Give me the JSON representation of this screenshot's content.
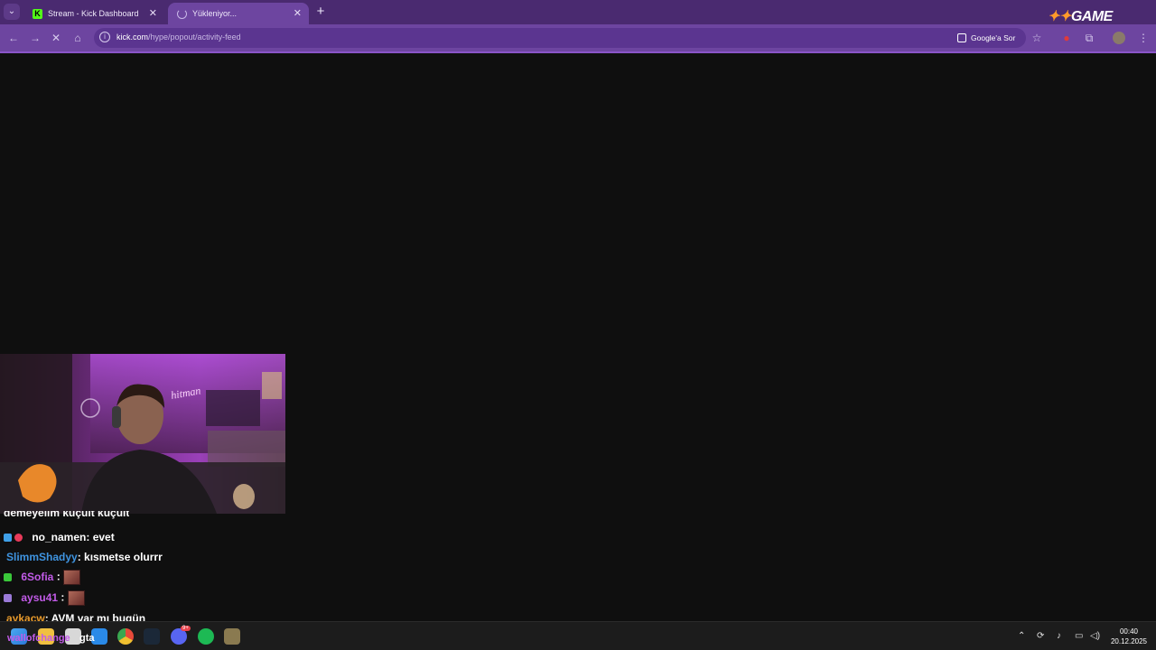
{
  "browser": {
    "tabs": [
      {
        "title": "Stream - Kick Dashboard",
        "favicon": "kick-icon"
      },
      {
        "title": "Yükleniyor...",
        "favicon": "loading-spinner-icon"
      }
    ],
    "url_host": "kick.com",
    "url_path": "/hype/popout/activity-feed",
    "google_sor": "Google'a Sor",
    "overlay_logo": "GAME",
    "theme_color": "#6d45a0"
  },
  "chat": {
    "partial_line": "demeyelim küçült küçült",
    "messages": [
      {
        "user": "no_namen",
        "text": ": evet",
        "user_color": "#ffffff",
        "emote": false
      },
      {
        "user": "SlimmShadyy",
        "text": ": kısmetse olurrr",
        "user_color": "#3f94e0",
        "emote": false
      },
      {
        "user": "6Sofia",
        "text": " :",
        "user_color": "#c25be8",
        "emote": true
      },
      {
        "user": "aysu41",
        "text": " :",
        "user_color": "#c25be8",
        "emote": true
      },
      {
        "user": "aykacw",
        "text": ": AVM var mı bugün",
        "user_color": "#e89a2b",
        "emote": false
      }
    ],
    "overlap_text": "wallofchange",
    "overlap_text2": "gta"
  },
  "taskbar": {
    "clock_time": "00:40",
    "clock_date": "20.12.2025",
    "discord_badge": "9+"
  }
}
